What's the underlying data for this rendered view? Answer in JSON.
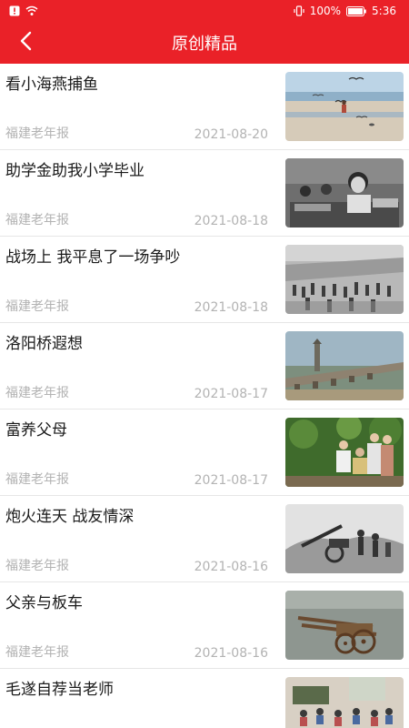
{
  "status_bar": {
    "battery_percent": "100%",
    "time": "5:36"
  },
  "header": {
    "title": "原创精品",
    "back_icon": "chevron-left-icon"
  },
  "articles": [
    {
      "title": "看小海燕捕鱼",
      "source": "福建老年报",
      "date": "2021-08-20",
      "image": "seagulls-beach-photo"
    },
    {
      "title": "助学金助我小学毕业",
      "source": "福建老年报",
      "date": "2021-08-18",
      "image": "classroom-girl-photo"
    },
    {
      "title": "战场上 我平息了一场争吵",
      "source": "福建老年报",
      "date": "2021-08-18",
      "image": "marching-crowd-photo"
    },
    {
      "title": "洛阳桥遐想",
      "source": "福建老年报",
      "date": "2021-08-17",
      "image": "stone-bridge-photo"
    },
    {
      "title": "富养父母",
      "source": "福建老年报",
      "date": "2021-08-17",
      "image": "family-elderly-photo"
    },
    {
      "title": "炮火连天 战友情深",
      "source": "福建老年报",
      "date": "2021-08-16",
      "image": "artillery-soldiers-photo"
    },
    {
      "title": "父亲与板车",
      "source": "福建老年报",
      "date": "2021-08-16",
      "image": "handcart-photo"
    },
    {
      "title": "毛遂自荐当老师",
      "source": "",
      "date": "",
      "image": "classroom-students-photo"
    }
  ]
}
